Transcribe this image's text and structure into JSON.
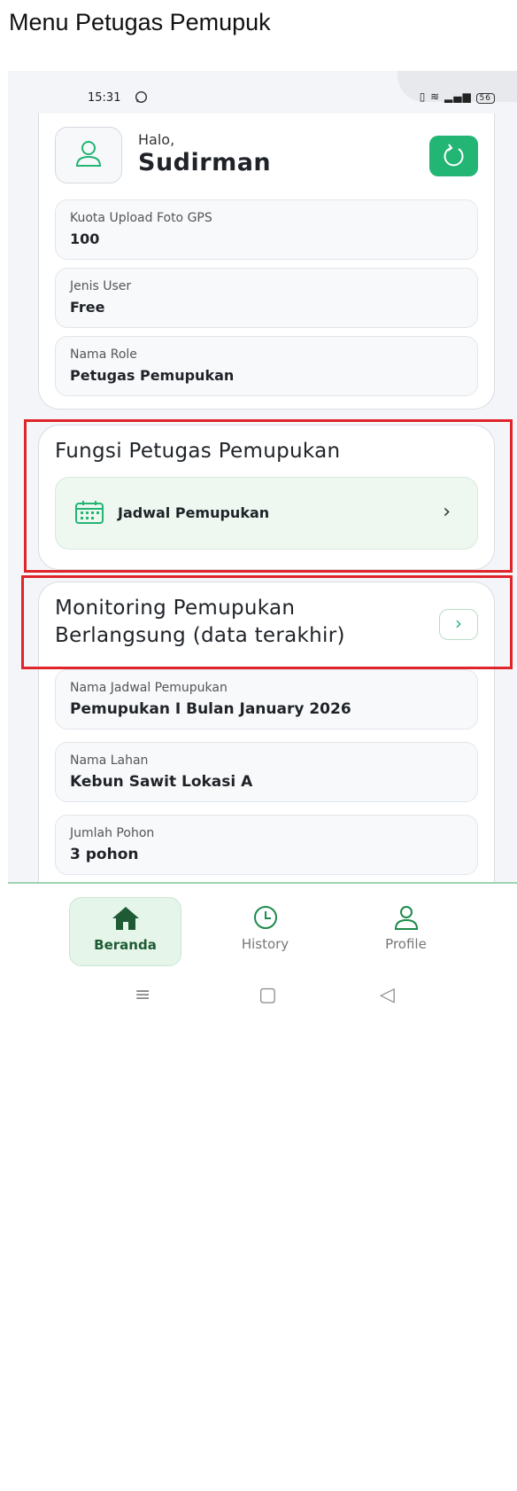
{
  "doc_title": "Menu Petugas Pemupuk",
  "statusbar": {
    "time": "15:31",
    "battery": "56"
  },
  "profile": {
    "greeting": "Halo,",
    "name": "Sudirman",
    "fields": [
      {
        "label": "Kuota Upload Foto GPS",
        "value": "100"
      },
      {
        "label": "Jenis User",
        "value": "Free"
      },
      {
        "label": "Nama Role",
        "value": "Petugas Pemupukan"
      }
    ]
  },
  "functions": {
    "title": "Fungsi Petugas Pemupukan",
    "jadwal_label": "Jadwal Pemupukan"
  },
  "monitoring": {
    "title_line1": "Monitoring Pemupukan",
    "title_line2": "Berlangsung (data terakhir)",
    "fields": [
      {
        "label": "Nama Jadwal Pemupukan",
        "value": "Pemupukan I Bulan January 2026"
      },
      {
        "label": "Nama Lahan",
        "value": "Kebun Sawit Lokasi A"
      },
      {
        "label": "Jumlah Pohon",
        "value": "3 pohon"
      }
    ]
  },
  "nav": {
    "home": "Beranda",
    "history": "History",
    "profile": "Profile"
  },
  "colors": {
    "accent": "#22b573",
    "highlight": "#e0242a",
    "nav_active_text": "#1e5b35"
  }
}
